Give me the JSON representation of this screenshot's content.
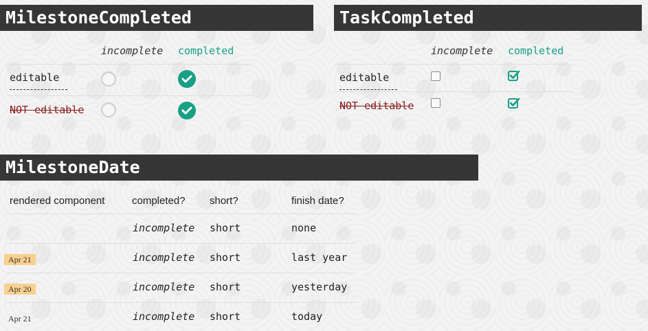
{
  "milestone_completed": {
    "title": "MilestoneCompleted",
    "columns": {
      "incomplete": "incomplete",
      "completed": "completed"
    },
    "rows": [
      {
        "label": "editable"
      },
      {
        "label": "NOT editable"
      }
    ]
  },
  "task_completed": {
    "title": "TaskCompleted",
    "columns": {
      "incomplete": "incomplete",
      "completed": "completed"
    },
    "rows": [
      {
        "label": "editable"
      },
      {
        "label": "NOT editable"
      }
    ]
  },
  "milestone_date": {
    "title": "MilestoneDate",
    "headers": [
      "rendered component",
      "completed?",
      "short?",
      "finish date?"
    ],
    "rows": [
      {
        "badge": "",
        "badge_highlight": false,
        "completed": "incomplete",
        "short": "short",
        "finish": "none"
      },
      {
        "badge": "Apr 21",
        "badge_highlight": true,
        "completed": "incomplete",
        "short": "short",
        "finish": "last year"
      },
      {
        "badge": "Apr 20",
        "badge_highlight": true,
        "completed": "incomplete",
        "short": "short",
        "finish": "yesterday"
      },
      {
        "badge": "Apr 21",
        "badge_highlight": false,
        "completed": "incomplete",
        "short": "short",
        "finish": "today"
      }
    ]
  },
  "colors": {
    "accent": "#17a085",
    "header_bg": "#363636",
    "badge_highlight": "#f9d08e",
    "not_editable": "#8b1a1a"
  },
  "icons": {
    "incomplete_milestone": "radio-empty-icon",
    "completed_milestone": "check-circle-icon",
    "incomplete_task": "checkbox-empty-icon",
    "completed_task": "checkbox-checked-icon"
  }
}
